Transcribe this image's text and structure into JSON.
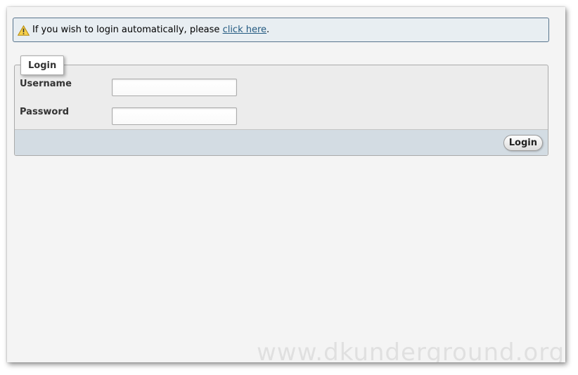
{
  "notice": {
    "text": "If you wish to login automatically, please ",
    "link_label": "click here",
    "suffix": "."
  },
  "login_form": {
    "legend": "Login",
    "username_label": "Username",
    "username_value": "",
    "password_label": "Password",
    "password_value": "",
    "submit_label": "Login"
  },
  "watermark": "www.dkunderground.org",
  "icons": {
    "notice_icon": "warning-icon"
  },
  "colors": {
    "notice_bg": "#e8eef2",
    "notice_border": "#58748c",
    "link": "#235a81",
    "footer_bg": "#d3dce3",
    "warning_yellow": "#f7d14a"
  }
}
